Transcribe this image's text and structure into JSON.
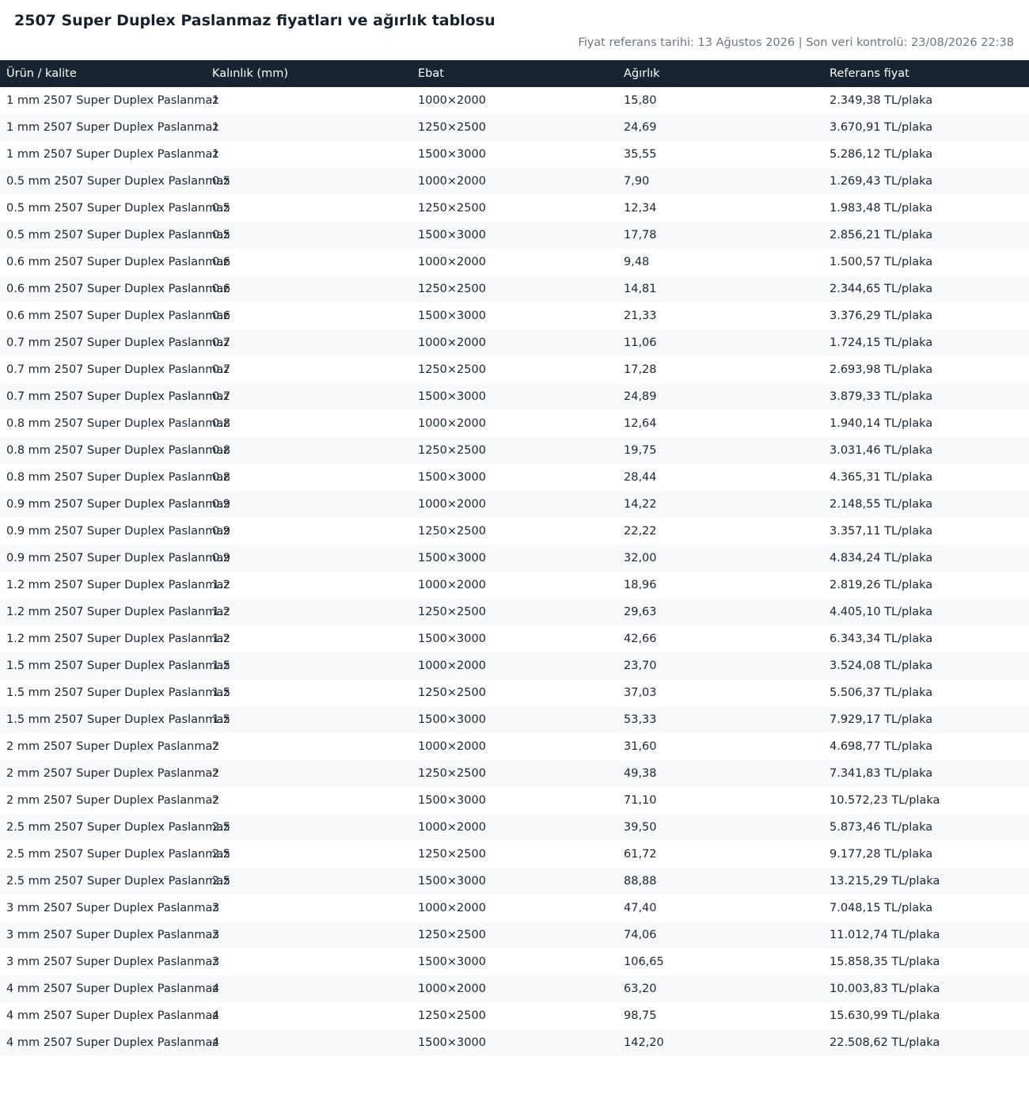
{
  "page": {
    "title": "2507 Super Duplex Paslanmaz fiyatları ve ağırlık tablosu",
    "meta": "Fiyat referans tarihi: 13 Ağustos 2026 | Son veri kontrolü: 23/08/2026 22:38"
  },
  "table": {
    "headers": [
      "Ürün / kalite",
      "Kalınlık (mm)",
      "Ebat",
      "Ağırlık",
      "Referans fiyat"
    ],
    "rows": [
      [
        "1 mm 2507 Super Duplex Paslanmaz",
        "1",
        "1000×2000",
        "15,80",
        "2.349,38 TL/plaka"
      ],
      [
        "1 mm 2507 Super Duplex Paslanmaz",
        "1",
        "1250×2500",
        "24,69",
        "3.670,91 TL/plaka"
      ],
      [
        "1 mm 2507 Super Duplex Paslanmaz",
        "1",
        "1500×3000",
        "35,55",
        "5.286,12 TL/plaka"
      ],
      [
        "0.5 mm 2507 Super Duplex Paslanmaz",
        "0.5",
        "1000×2000",
        "7,90",
        "1.269,43 TL/plaka"
      ],
      [
        "0.5 mm 2507 Super Duplex Paslanmaz",
        "0.5",
        "1250×2500",
        "12,34",
        "1.983,48 TL/plaka"
      ],
      [
        "0.5 mm 2507 Super Duplex Paslanmaz",
        "0.5",
        "1500×3000",
        "17,78",
        "2.856,21 TL/plaka"
      ],
      [
        "0.6 mm 2507 Super Duplex Paslanmaz",
        "0.6",
        "1000×2000",
        "9,48",
        "1.500,57 TL/plaka"
      ],
      [
        "0.6 mm 2507 Super Duplex Paslanmaz",
        "0.6",
        "1250×2500",
        "14,81",
        "2.344,65 TL/plaka"
      ],
      [
        "0.6 mm 2507 Super Duplex Paslanmaz",
        "0.6",
        "1500×3000",
        "21,33",
        "3.376,29 TL/plaka"
      ],
      [
        "0.7 mm 2507 Super Duplex Paslanmaz",
        "0.7",
        "1000×2000",
        "11,06",
        "1.724,15 TL/plaka"
      ],
      [
        "0.7 mm 2507 Super Duplex Paslanmaz",
        "0.7",
        "1250×2500",
        "17,28",
        "2.693,98 TL/plaka"
      ],
      [
        "0.7 mm 2507 Super Duplex Paslanmaz",
        "0.7",
        "1500×3000",
        "24,89",
        "3.879,33 TL/plaka"
      ],
      [
        "0.8 mm 2507 Super Duplex Paslanmaz",
        "0.8",
        "1000×2000",
        "12,64",
        "1.940,14 TL/plaka"
      ],
      [
        "0.8 mm 2507 Super Duplex Paslanmaz",
        "0.8",
        "1250×2500",
        "19,75",
        "3.031,46 TL/plaka"
      ],
      [
        "0.8 mm 2507 Super Duplex Paslanmaz",
        "0.8",
        "1500×3000",
        "28,44",
        "4.365,31 TL/plaka"
      ],
      [
        "0.9 mm 2507 Super Duplex Paslanmaz",
        "0.9",
        "1000×2000",
        "14,22",
        "2.148,55 TL/plaka"
      ],
      [
        "0.9 mm 2507 Super Duplex Paslanmaz",
        "0.9",
        "1250×2500",
        "22,22",
        "3.357,11 TL/plaka"
      ],
      [
        "0.9 mm 2507 Super Duplex Paslanmaz",
        "0.9",
        "1500×3000",
        "32,00",
        "4.834,24 TL/plaka"
      ],
      [
        "1.2 mm 2507 Super Duplex Paslanmaz",
        "1.2",
        "1000×2000",
        "18,96",
        "2.819,26 TL/plaka"
      ],
      [
        "1.2 mm 2507 Super Duplex Paslanmaz",
        "1.2",
        "1250×2500",
        "29,63",
        "4.405,10 TL/plaka"
      ],
      [
        "1.2 mm 2507 Super Duplex Paslanmaz",
        "1.2",
        "1500×3000",
        "42,66",
        "6.343,34 TL/plaka"
      ],
      [
        "1.5 mm 2507 Super Duplex Paslanmaz",
        "1.5",
        "1000×2000",
        "23,70",
        "3.524,08 TL/plaka"
      ],
      [
        "1.5 mm 2507 Super Duplex Paslanmaz",
        "1.5",
        "1250×2500",
        "37,03",
        "5.506,37 TL/plaka"
      ],
      [
        "1.5 mm 2507 Super Duplex Paslanmaz",
        "1.5",
        "1500×3000",
        "53,33",
        "7.929,17 TL/plaka"
      ],
      [
        "2 mm 2507 Super Duplex Paslanmaz",
        "2",
        "1000×2000",
        "31,60",
        "4.698,77 TL/plaka"
      ],
      [
        "2 mm 2507 Super Duplex Paslanmaz",
        "2",
        "1250×2500",
        "49,38",
        "7.341,83 TL/plaka"
      ],
      [
        "2 mm 2507 Super Duplex Paslanmaz",
        "2",
        "1500×3000",
        "71,10",
        "10.572,23 TL/plaka"
      ],
      [
        "2.5 mm 2507 Super Duplex Paslanmaz",
        "2.5",
        "1000×2000",
        "39,50",
        "5.873,46 TL/plaka"
      ],
      [
        "2.5 mm 2507 Super Duplex Paslanmaz",
        "2.5",
        "1250×2500",
        "61,72",
        "9.177,28 TL/plaka"
      ],
      [
        "2.5 mm 2507 Super Duplex Paslanmaz",
        "2.5",
        "1500×3000",
        "88,88",
        "13.215,29 TL/plaka"
      ],
      [
        "3 mm 2507 Super Duplex Paslanmaz",
        "3",
        "1000×2000",
        "47,40",
        "7.048,15 TL/plaka"
      ],
      [
        "3 mm 2507 Super Duplex Paslanmaz",
        "3",
        "1250×2500",
        "74,06",
        "11.012,74 TL/plaka"
      ],
      [
        "3 mm 2507 Super Duplex Paslanmaz",
        "3",
        "1500×3000",
        "106,65",
        "15.858,35 TL/plaka"
      ],
      [
        "4 mm 2507 Super Duplex Paslanmaz",
        "4",
        "1000×2000",
        "63,20",
        "10.003,83 TL/plaka"
      ],
      [
        "4 mm 2507 Super Duplex Paslanmaz",
        "4",
        "1250×2500",
        "98,75",
        "15.630,99 TL/plaka"
      ],
      [
        "4 mm 2507 Super Duplex Paslanmaz",
        "4",
        "1500×3000",
        "142,20",
        "22.508,62 TL/plaka"
      ]
    ]
  }
}
